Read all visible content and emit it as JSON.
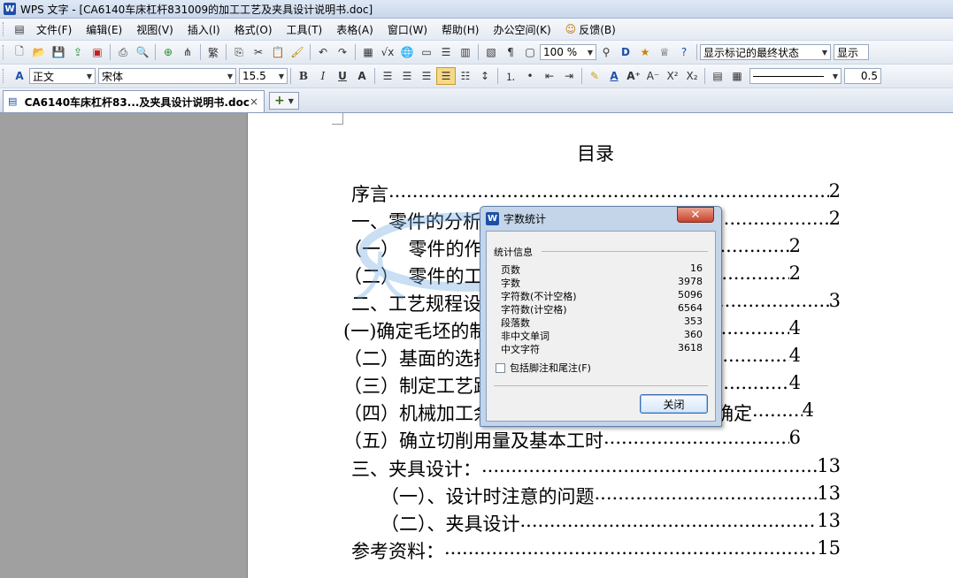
{
  "window": {
    "title": "WPS 文字 - [CA6140车床杠杆831009的加工工艺及夹具设计说明书.doc]",
    "app_icon": "W"
  },
  "menu": {
    "items": [
      "文件(F)",
      "编辑(E)",
      "视图(V)",
      "插入(I)",
      "格式(O)",
      "工具(T)",
      "表格(A)",
      "窗口(W)",
      "帮助(H)",
      "办公空间(K)",
      "反馈(B)"
    ]
  },
  "toolbar": {
    "zoom": "100 %",
    "track_changes": "显示标记的最终状态",
    "show_label": "显示",
    "style": "正文",
    "font": "宋体",
    "font_size": "15.5",
    "line_width": "0.5"
  },
  "tabs": {
    "doc_tab": "CA6140车床杠杆83...及夹具设计说明书.doc",
    "close_glyph": "×",
    "new_tab_glyph": "+"
  },
  "document": {
    "title": "目录",
    "toc": [
      {
        "label": "序言",
        "page": "2"
      },
      {
        "label": "一、零件的分析",
        "page": "2"
      },
      {
        "label": "（一）　零件的作用",
        "page": "2"
      },
      {
        "label": "（二）　零件的工艺分析",
        "page": "2"
      },
      {
        "label": "二、工艺规程设计",
        "page": "3"
      },
      {
        "label": "(一)确定毛坯的制造形式",
        "page": "4"
      },
      {
        "label": "（二）基面的选择",
        "page": "4"
      },
      {
        "label": "（三）制定工艺路线",
        "page": "4"
      },
      {
        "label": "（四）机械加工余量、工序尺寸及毛坯尺寸的确定",
        "page": "4"
      },
      {
        "label": "（五）确立切削用量及基本工时",
        "page": "6"
      },
      {
        "label": "三、夹具设计：",
        "page": "13"
      },
      {
        "label": "（一）、设计时注意的问题",
        "page": "13"
      },
      {
        "label": "（二）、夹具设计",
        "page": "13"
      },
      {
        "label": "参考资料：",
        "page": "15"
      }
    ]
  },
  "dialog": {
    "title": "字数统计",
    "close_glyph": "✕",
    "group_label": "统计信息",
    "stats": [
      {
        "label": "页数",
        "value": "16"
      },
      {
        "label": "字数",
        "value": "3978"
      },
      {
        "label": "字符数(不计空格)",
        "value": "5096"
      },
      {
        "label": "字符数(计空格)",
        "value": "6564"
      },
      {
        "label": "段落数",
        "value": "353"
      },
      {
        "label": "非中文单词",
        "value": "360"
      },
      {
        "label": "中文字符",
        "value": "3618"
      }
    ],
    "checkbox_label": "包括脚注和尾注(F)",
    "close_button": "关闭"
  }
}
